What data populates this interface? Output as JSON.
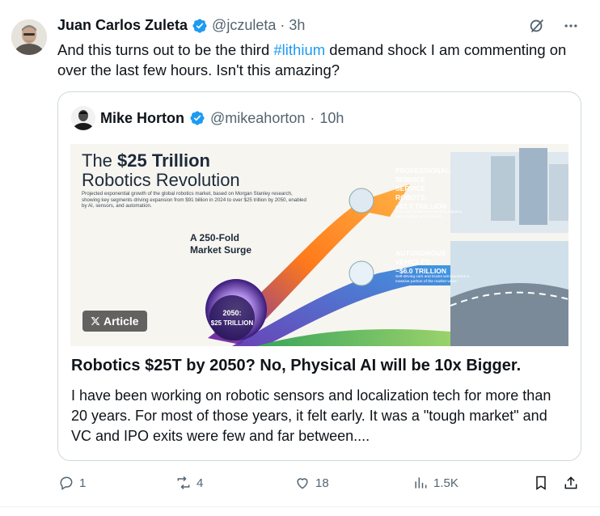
{
  "tweet": {
    "author_name": "Juan Carlos Zuleta",
    "handle": "@jczuleta",
    "separator": "·",
    "time": "3h",
    "text_before": "And this turns out to be the third ",
    "hashtag": "#lithium",
    "text_after": " demand shock I am commenting on over the last few hours. Isn't this amazing?"
  },
  "quote": {
    "author_name": "Mike Horton",
    "handle": "@mikeahorton",
    "separator": "·",
    "time": "10h",
    "article_badge": "Article",
    "article_title": "Robotics $25T by 2050?  No, Physical AI will be 10x Bigger.",
    "article_excerpt": "I have been working on robotic sensors and localization tech for more than 20 years.  For most of those years, it felt early.  It was a \"tough market\" and VC and IPO exits were few and far between....",
    "image": {
      "title_line1_pre": "The ",
      "title_line1_bold": "$25 Trillion",
      "title_line2": "Robotics Revolution",
      "subtitle": "Projected exponential growth of the global robotics market, based on Morgan Stanley research, showing key segments driving expansion from $91 billion in 2024 to over $25 trillion by 2050, enabled by AI, sensors, and automation.",
      "surge_line1": "A 250-Fold",
      "surge_line2": "Market Surge",
      "badge_line1": "2050:",
      "badge_line2": "$25 TRILLION",
      "seg1_line1": "PROFESSIONAL",
      "seg1_line2": "SERVICE",
      "seg1_line3": "SERVICE",
      "seg1_line4": "ROBOTS:",
      "seg1_value": "~$7.5 TRILLION",
      "seg1_note": "Expected to lead transforming logistics, warehousing, and services",
      "seg2_line1": "AUTONOMOUS",
      "seg2_line2": "VEHICLES:",
      "seg2_value": "~$6.0 TRILLION",
      "seg2_note": "Self-driving cars and trucks will represent a massive portion of the market value."
    }
  },
  "actions": {
    "replies": "1",
    "reposts": "4",
    "likes": "18",
    "views": "1.5K"
  },
  "colors": {
    "accent": "#1d9bf0",
    "text": "#0f1419",
    "secondary": "#536471",
    "border": "#cfd9de"
  },
  "icons": {
    "verified": "verified-badge-icon",
    "grok": "grok-icon",
    "more": "more-icon",
    "reply": "reply-icon",
    "repost": "repost-icon",
    "like": "like-icon",
    "views": "views-icon",
    "bookmark": "bookmark-icon",
    "share": "share-icon",
    "x_logo": "x-logo-icon"
  }
}
